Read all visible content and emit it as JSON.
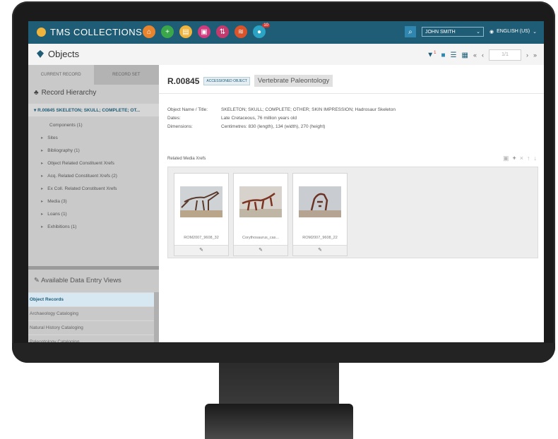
{
  "app": {
    "brand": "TMS COLLECTIONS"
  },
  "topbar": {
    "notification_count": "10",
    "user": "JOHN SMITH",
    "language": "ENGLISH (US)"
  },
  "subheader": {
    "module_title": "Objects",
    "pager": "1/1",
    "filter_count": "1"
  },
  "sidebar": {
    "tabs": [
      "CURRENT RECORD",
      "RECORD SET"
    ],
    "hierarchy_title": "Record Hierarchy",
    "root_item": "R.00845 SKELETON; SKULL; COMPLETE; OT...",
    "items": [
      "Components (1)",
      "Sites",
      "Bibliography (1)",
      "Object Related Constituent Xrefs",
      "Acq. Related Constituent Xrefs (2)",
      "Ex Coll. Related Constituent Xrefs",
      "Media (3)",
      "Loans (1)",
      "Exhibitions (1)"
    ],
    "views_title": "Available Data Entry Views",
    "views": [
      "Object Records",
      "Archaeology Cataloging",
      "Natural History Cataloging",
      "Paleontology Cataloging"
    ]
  },
  "record": {
    "number": "R.00845",
    "status_badge": "ACCESSIONED OBJECT",
    "department": "Vertebrate Paleontology",
    "fields": [
      {
        "label": "Object Name / Title:",
        "value": "SKELETON; SKULL; COMPLETE; OTHER; SKIN IMPRESSION; Hadrosaur Skeleton"
      },
      {
        "label": "Dates:",
        "value": "Late Cretaceous, 76 million years old"
      },
      {
        "label": "Dimensions:",
        "value": "Centimetres: 830 (length), 134 (width), 270 (height)"
      }
    ]
  },
  "related_media": {
    "label": "Related Media Xrefs",
    "items": [
      {
        "caption": "ROM2007_9608_32",
        "edit": "✎"
      },
      {
        "caption": "Corythosaurus_cas...",
        "edit": "✎"
      },
      {
        "caption": "ROM2007_9608_22",
        "edit": "✎"
      }
    ]
  },
  "colors": {
    "topbar": "#1f5c75",
    "accent_orange": "#e8842d",
    "accent_green": "#3aa84a",
    "accent_pink": "#d13b7e",
    "sidebar": "#c9c9c9"
  }
}
